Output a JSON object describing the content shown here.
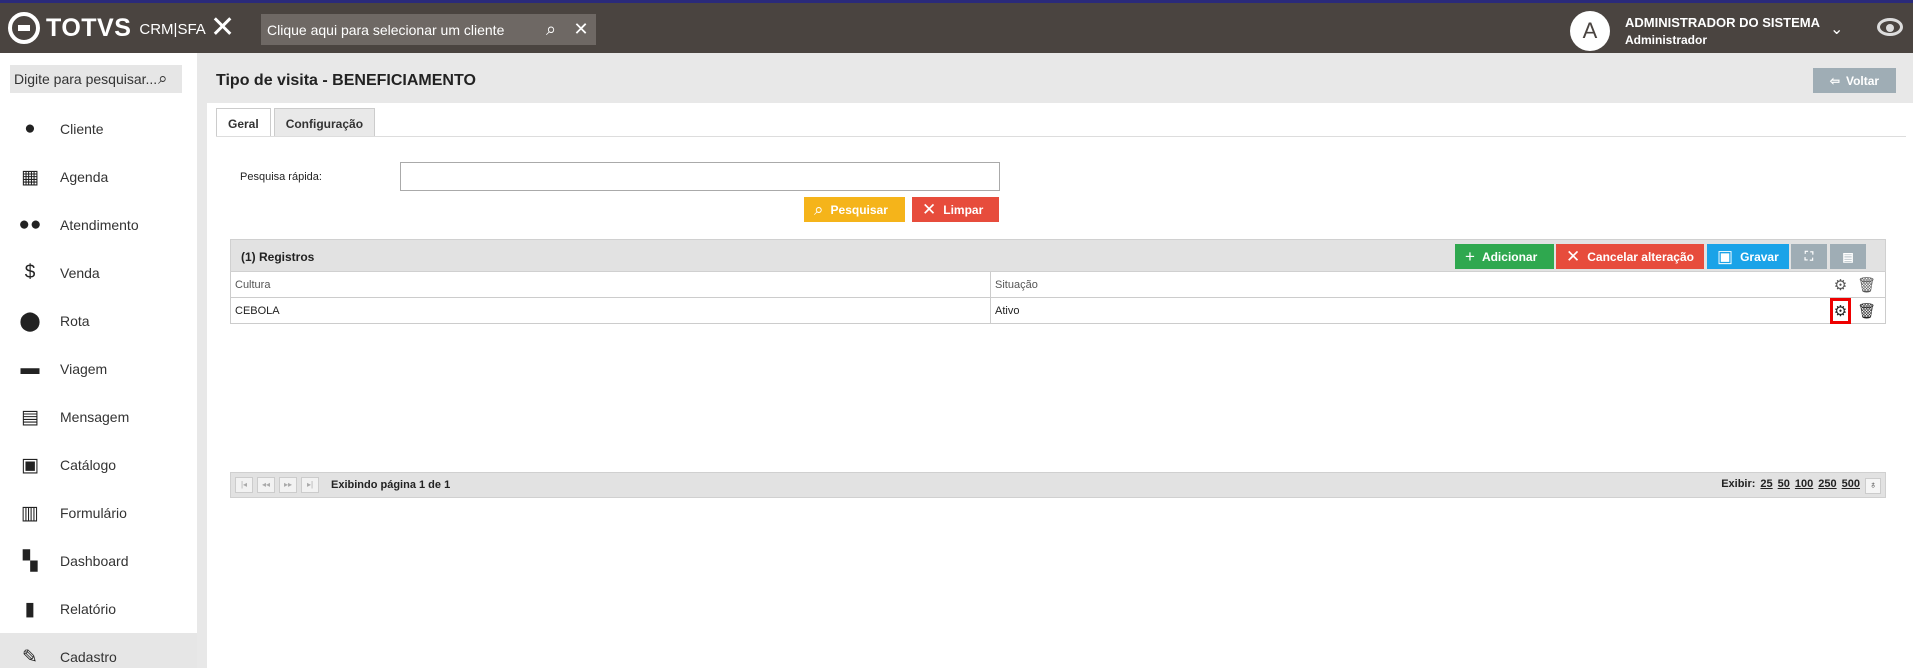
{
  "topbar": {
    "brand": "TOTVS",
    "brand_sub": "CRM|SFA",
    "client_placeholder": "Clique aqui para selecionar um cliente",
    "avatar_letter": "A",
    "user_name": "ADMINISTRADOR DO SISTEMA",
    "user_role": "Administrador"
  },
  "sidebar": {
    "search_placeholder": "Digite para pesquisar...",
    "items": [
      {
        "label": "Cliente",
        "icon": "person-icon"
      },
      {
        "label": "Agenda",
        "icon": "calendar-icon"
      },
      {
        "label": "Atendimento",
        "icon": "people-icon"
      },
      {
        "label": "Venda",
        "icon": "dollar-icon"
      },
      {
        "label": "Rota",
        "icon": "map-pin-icon"
      },
      {
        "label": "Viagem",
        "icon": "car-icon"
      },
      {
        "label": "Mensagem",
        "icon": "message-icon"
      },
      {
        "label": "Catálogo",
        "icon": "image-icon"
      },
      {
        "label": "Formulário",
        "icon": "clipboard-icon"
      },
      {
        "label": "Dashboard",
        "icon": "dashboard-icon"
      },
      {
        "label": "Relatório",
        "icon": "bar-chart-icon"
      },
      {
        "label": "Cadastro",
        "icon": "pencil-icon"
      }
    ]
  },
  "page": {
    "title": "Tipo de visita - BENEFICIAMENTO",
    "back_label": "Voltar",
    "tabs": [
      "Geral",
      "Configuração"
    ],
    "quick_search_label": "Pesquisa rápida:",
    "search_button": "Pesquisar",
    "clear_button": "Limpar"
  },
  "grid": {
    "count_label": "(1) Registros",
    "add_label": "Adicionar",
    "cancel_label": "Cancelar alteração",
    "save_label": "Gravar",
    "columns": [
      "Cultura",
      "Situação"
    ],
    "rows": [
      {
        "cultura": "CEBOLA",
        "situacao": "Ativo"
      }
    ],
    "pager_info": "Exibindo página 1 de 1",
    "show_label": "Exibir:",
    "page_sizes": [
      "25",
      "50",
      "100",
      "250",
      "500"
    ]
  }
}
